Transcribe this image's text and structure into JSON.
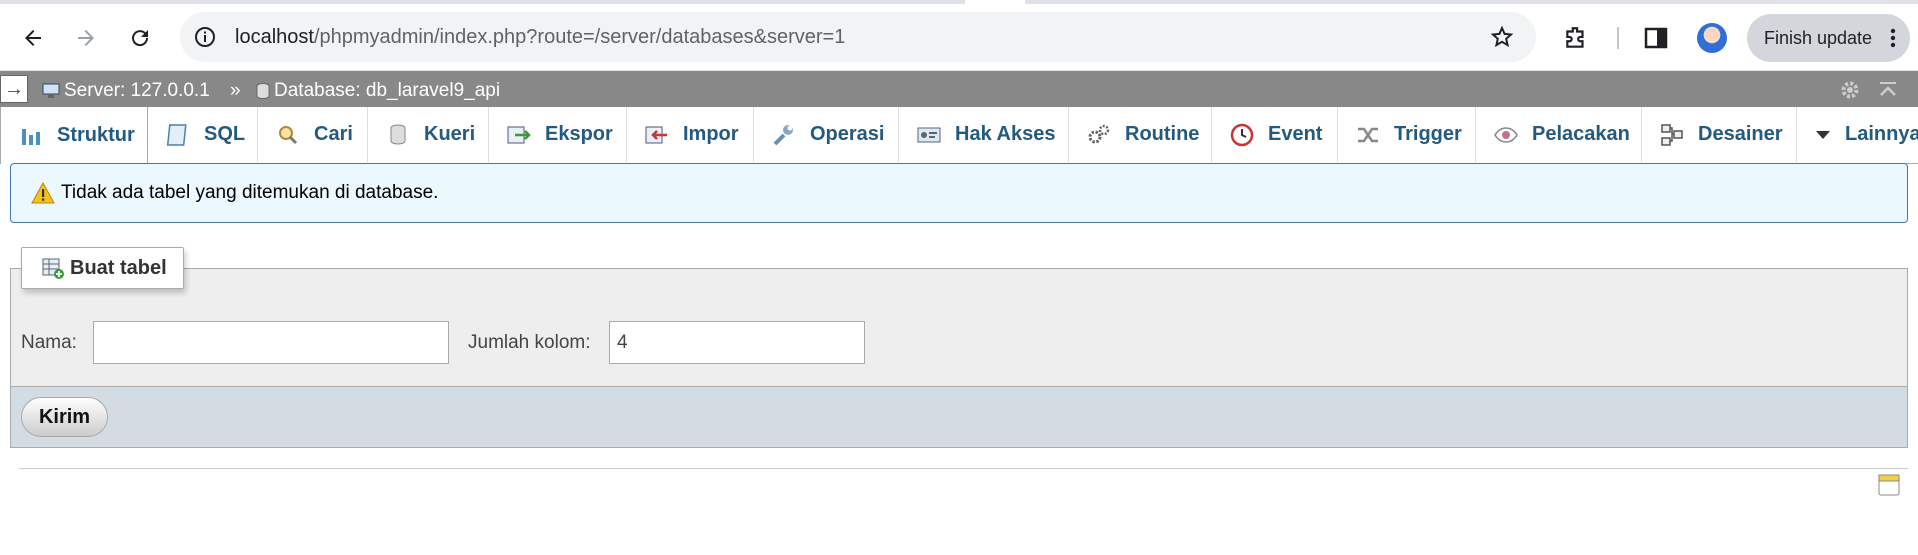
{
  "browser": {
    "url_host": "localhost",
    "url_path": "/phpmyadmin/index.php?route=/server/databases&server=1",
    "finish_update_label": "Finish update"
  },
  "breadcrumb": {
    "arrow": "→",
    "server_label": "Server: 127.0.0.1",
    "separator": "»",
    "database_label": "Database: db_laravel9_api"
  },
  "tabs": [
    {
      "label": "Struktur",
      "icon": "structure-icon",
      "active": true
    },
    {
      "label": "SQL",
      "icon": "sql-icon"
    },
    {
      "label": "Cari",
      "icon": "search-icon"
    },
    {
      "label": "Kueri",
      "icon": "query-icon"
    },
    {
      "label": "Ekspor",
      "icon": "export-icon"
    },
    {
      "label": "Impor",
      "icon": "import-icon"
    },
    {
      "label": "Operasi",
      "icon": "wrench-icon"
    },
    {
      "label": "Hak Akses",
      "icon": "privileges-icon"
    },
    {
      "label": "Routine",
      "icon": "routine-icon"
    },
    {
      "label": "Event",
      "icon": "clock-icon"
    },
    {
      "label": "Trigger",
      "icon": "trigger-icon"
    },
    {
      "label": "Pelacakan",
      "icon": "eye-icon"
    },
    {
      "label": "Desainer",
      "icon": "designer-icon"
    },
    {
      "label": "Lainnya",
      "icon": "chevron-down-icon"
    }
  ],
  "notice": {
    "text": "Tidak ada tabel yang ditemukan di database."
  },
  "create_table": {
    "legend": "Buat tabel",
    "name_label": "Nama:",
    "name_value": "",
    "columns_label": "Jumlah kolom:",
    "columns_value": "4",
    "submit_label": "Kirim"
  },
  "colors": {
    "tab_text": "#235a81",
    "topbar": "#888888",
    "notice_bg": "#ebf8fd",
    "footer_bg": "#d3dce3"
  }
}
